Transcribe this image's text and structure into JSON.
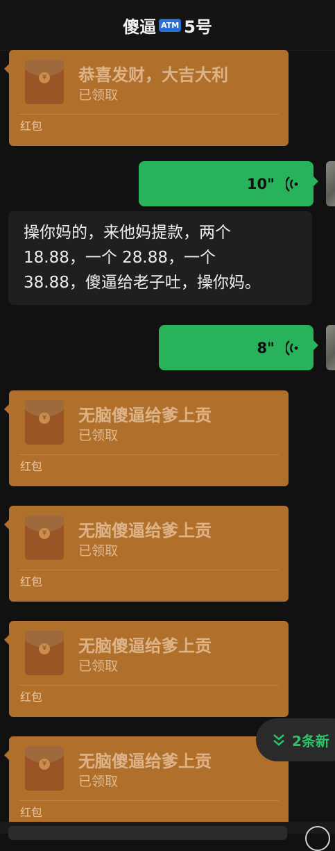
{
  "header": {
    "title_before": "傻逼",
    "atm_badge": "ATM",
    "title_after": "5号"
  },
  "packets": [
    {
      "title": "恭喜发财，大吉大利",
      "status": "已领取",
      "footer": "红包"
    },
    {
      "title": "无脑傻逼给爹上贡",
      "status": "已领取",
      "footer": "红包"
    },
    {
      "title": "无脑傻逼给爹上贡",
      "status": "已领取",
      "footer": "红包"
    },
    {
      "title": "无脑傻逼给爹上贡",
      "status": "已领取",
      "footer": "红包"
    },
    {
      "title": "无脑傻逼给爹上贡",
      "status": "已领取",
      "footer": "红包"
    }
  ],
  "voices": [
    {
      "duration": "10\""
    },
    {
      "duration": "8\""
    }
  ],
  "text_message": {
    "line1": "操你妈的，来他妈提款，两个",
    "line2": "18.88，一个 28.88，一个",
    "line3": "38.88，傻逼给老子吐，操你妈。"
  },
  "new_messages": {
    "label": "2条新"
  },
  "icons": {
    "envelope_seal": "red-packet-icon",
    "voice": "voice-wave-icon",
    "chevron": "double-chevron-down-icon"
  },
  "colors": {
    "background": "#111111",
    "red_packet": "#b0702b",
    "voice_bubble": "#29b25c",
    "text_bubble": "#1f1f1f",
    "new_message_text": "#2cc46a"
  }
}
